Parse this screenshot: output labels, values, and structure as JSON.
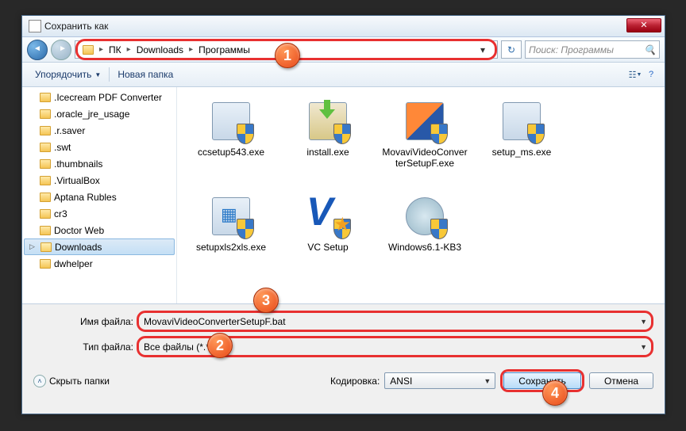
{
  "title": "Сохранить как",
  "breadcrumb": {
    "seg1": "ПК",
    "seg2": "Downloads",
    "seg3": "Программы"
  },
  "search": {
    "placeholder": "Поиск: Программы"
  },
  "toolbar": {
    "organize": "Упорядочить",
    "newfolder": "Новая папка"
  },
  "tree": {
    "items": [
      ".Icecream PDF Converter",
      ".oracle_jre_usage",
      ".r.saver",
      ".swt",
      ".thumbnails",
      ".VirtualBox",
      "Aptana Rubles",
      "cr3",
      "Doctor Web",
      "Downloads",
      "dwhelper"
    ],
    "selected_index": 9
  },
  "files": [
    {
      "name": "ccsetup543.exe",
      "icon": "cc"
    },
    {
      "name": "install.exe",
      "icon": "install"
    },
    {
      "name": "MovaviVideoConverterSetupF.exe",
      "icon": "movavi"
    },
    {
      "name": "setup_ms.exe",
      "icon": "ms"
    },
    {
      "name": "setupxls2xls.exe",
      "icon": "xls"
    },
    {
      "name": "VC Setup",
      "icon": "vc"
    },
    {
      "name": "Windows6.1-KB3",
      "icon": "kb"
    }
  ],
  "fields": {
    "filename_label": "Имя файла:",
    "filename_value": "MovaviVideoConverterSetupF.bat",
    "filetype_label": "Тип файла:",
    "filetype_value": "Все файлы (*.*)"
  },
  "footer": {
    "hide_folders": "Скрыть папки",
    "encoding_label": "Кодировка:",
    "encoding_value": "ANSI",
    "save": "Сохранить",
    "cancel": "Отмена"
  },
  "markers": {
    "m1": "1",
    "m2": "2",
    "m3": "3",
    "m4": "4"
  }
}
